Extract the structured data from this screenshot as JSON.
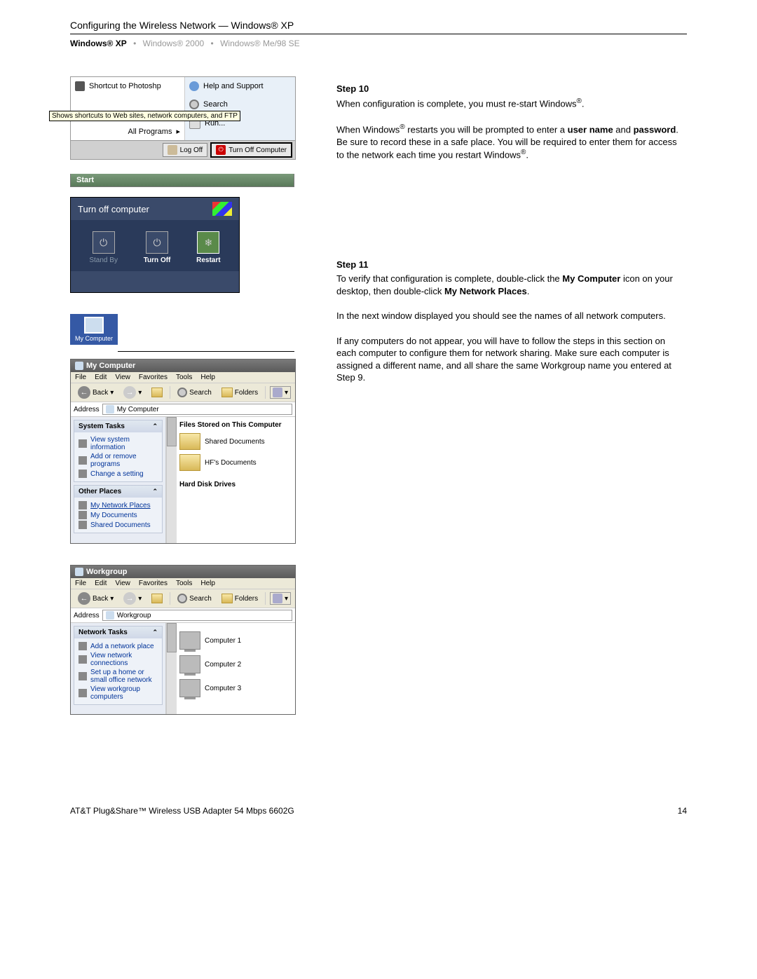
{
  "header": {
    "title": "Configuring the Wireless Network — Windows® XP",
    "nav_active": "Windows® XP",
    "nav_2": "Windows® 2000",
    "nav_3": "Windows® Me/98 SE",
    "sep": "•"
  },
  "startmenu": {
    "photoshop": "Shortcut to Photoshp",
    "allprograms": "All Programs",
    "help": "Help and Support",
    "search": "Search",
    "run": "Run...",
    "logoff": "Log Off",
    "turnoff": "Turn Off Computer",
    "start": "Start"
  },
  "turnoff": {
    "title": "Turn off computer",
    "standby": "Stand By",
    "turnoff": "Turn Off",
    "restart": "Restart"
  },
  "mycomputer": {
    "label": "My Computer"
  },
  "explorer1": {
    "title": "My Computer",
    "menu": [
      "File",
      "Edit",
      "View",
      "Favorites",
      "Tools",
      "Help"
    ],
    "back": "Back",
    "search": "Search",
    "folders": "Folders",
    "address_label": "Address",
    "address_value": "My Computer",
    "systasks": "System Tasks",
    "t1": "View system information",
    "t2": "Add or remove programs",
    "t3": "Change a setting",
    "other": "Other Places",
    "o1": "My Network Places",
    "o2": "My Documents",
    "o3": "Shared Documents",
    "files_head": "Files Stored on This Computer",
    "shared": "Shared Documents",
    "hpdocs": "HF's Documents",
    "hdd_head": "Hard Disk Drives",
    "tooltip": "Shows shortcuts to Web sites, network computers, and FTP"
  },
  "explorer2": {
    "title": "Workgroup",
    "menu": [
      "File",
      "Edit",
      "View",
      "Favorites",
      "Tools",
      "Help"
    ],
    "back": "Back",
    "search": "Search",
    "folders": "Folders",
    "address_label": "Address",
    "address_value": "Workgroup",
    "nettasks": "Network Tasks",
    "n1": "Add a network place",
    "n2": "View network connections",
    "n3": "Set up a home or small office network",
    "n4": "View workgroup computers",
    "c1": "Computer 1",
    "c2": "Computer 2",
    "c3": "Computer 3"
  },
  "step10": {
    "title": "Step 10",
    "p1a": "When configuration is complete, you must re-start Windows",
    "p1b": ".",
    "p2a": "When Windows",
    "p2b": " restarts you will be prompted to enter a ",
    "p2_user": "user name",
    "p2c": " and ",
    "p2_pass": "password",
    "p2d": ". Be sure to record these in a safe place. You will be required to enter them for access to the network each time you restart Windows",
    "p2e": "."
  },
  "step11": {
    "title": "Step 11",
    "p1a": "To verify that configuration is complete, double-click the ",
    "p1_mc": "My Computer",
    "p1b": " icon on your desktop, then double-click ",
    "p1_np": "My Network Places",
    "p1c": ".",
    "p2": "In the next window displayed you should see the names of all network computers.",
    "p3": "If any computers do not appear, you will have to follow the steps in this section on each computer to configure them for network sharing. Make sure each computer is assigned a different name, and all share the same Workgroup name you entered at Step 9."
  },
  "footer": {
    "left": "AT&T Plug&Share™ Wireless USB Adapter 54 Mbps 6602G",
    "page": "14"
  },
  "glyphs": {
    "reg": "®",
    "chev": "⌃",
    "tri": "▸",
    "dropdown": "▾",
    "power": "⏻",
    "restart": "❄",
    "back": "←",
    "fwd": "→",
    "up": "↑"
  }
}
